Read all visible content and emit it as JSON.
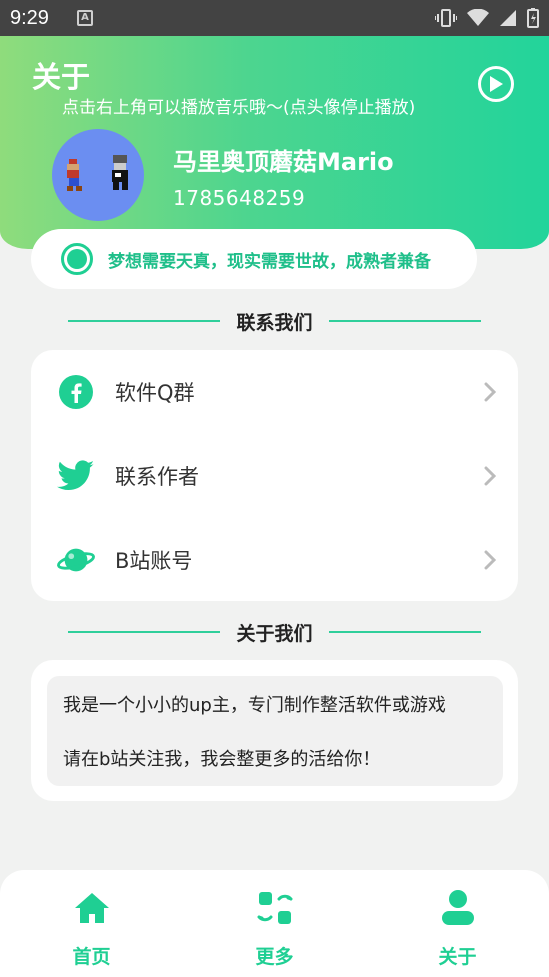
{
  "status_bar": {
    "time": "9:29",
    "notification_icon": "A"
  },
  "header": {
    "title": "关于",
    "subtitle": "点击右上角可以播放音乐哦～(点头像停止播放)",
    "name": "马里奥顶蘑菇Mario",
    "phone": "1785648259"
  },
  "motto": {
    "text": "梦想需要天真，现实需要世故，成熟者兼备"
  },
  "contact_section": {
    "title": "联系我们",
    "items": [
      {
        "label": "软件Q群",
        "icon": "facebook-icon"
      },
      {
        "label": "联系作者",
        "icon": "twitter-icon"
      },
      {
        "label": "B站账号",
        "icon": "planet-icon"
      }
    ]
  },
  "about_section": {
    "title": "关于我们",
    "line1": "我是一个小小的up主，专门制作整活软件或游戏",
    "line2": "请在b站关注我，我会整更多的活给你！"
  },
  "bottom_nav": {
    "items": [
      {
        "label": "首页",
        "icon": "home-icon"
      },
      {
        "label": "更多",
        "icon": "apps-icon"
      },
      {
        "label": "关于",
        "icon": "user-icon"
      }
    ]
  },
  "colors": {
    "accent": "#1fcf93",
    "header_start": "#8fdc7c",
    "header_end": "#22d49b"
  }
}
